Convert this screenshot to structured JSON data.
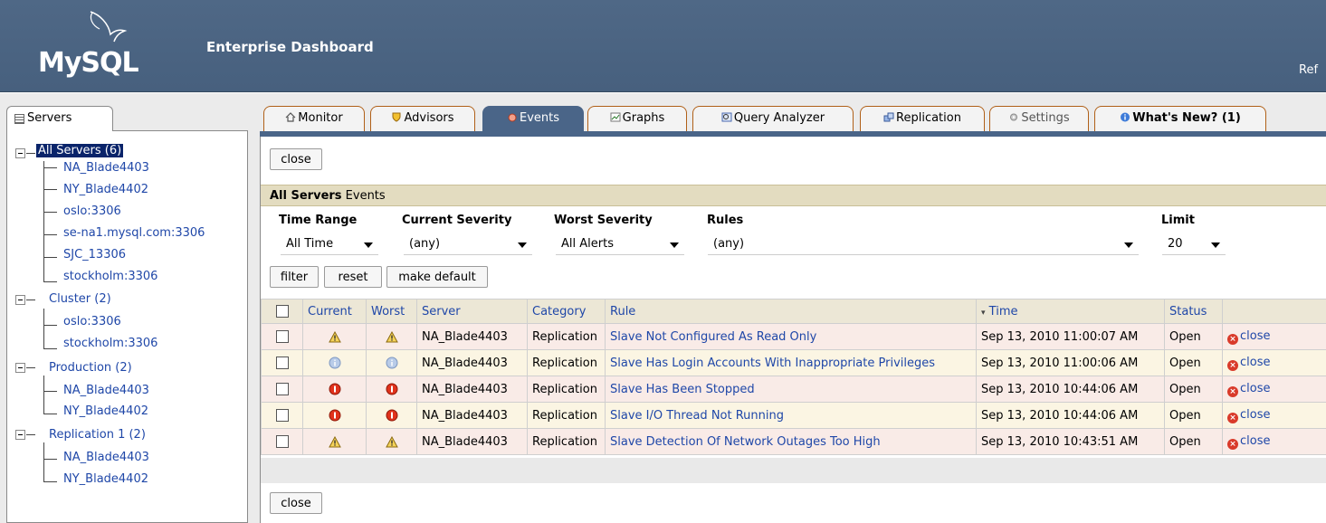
{
  "header": {
    "logo_text": "MySQL",
    "app_title": "Enterprise Dashboard",
    "right_text": "Ref"
  },
  "sidebar": {
    "tab_label": "Servers",
    "tree": [
      {
        "label": "All Servers (6)",
        "selected": true
      },
      {
        "label": "NA_Blade4403"
      },
      {
        "label": "NY_Blade4402"
      },
      {
        "label": "oslo:3306"
      },
      {
        "label": "se-na1.mysql.com:3306"
      },
      {
        "label": "SJC_13306"
      },
      {
        "label": "stockholm:3306"
      },
      {
        "label": "Cluster (2)"
      },
      {
        "label": "oslo:3306"
      },
      {
        "label": "stockholm:3306"
      },
      {
        "label": "Production (2)"
      },
      {
        "label": "NA_Blade4403"
      },
      {
        "label": "NY_Blade4402"
      },
      {
        "label": "Replication 1 (2)"
      },
      {
        "label": "NA_Blade4403"
      },
      {
        "label": "NY_Blade4402"
      }
    ]
  },
  "tabs": [
    {
      "label": "Monitor",
      "icon": "house-icon"
    },
    {
      "label": "Advisors",
      "icon": "shield-icon"
    },
    {
      "label": "Events",
      "icon": "alarm-icon",
      "active": true
    },
    {
      "label": "Graphs",
      "icon": "chart-icon"
    },
    {
      "label": "Query Analyzer",
      "icon": "magnifier-icon"
    },
    {
      "label": "Replication",
      "icon": "replication-icon"
    },
    {
      "label": "Settings",
      "icon": "gear-icon"
    },
    {
      "label": "What's New? (1)",
      "icon": "info-icon"
    }
  ],
  "main": {
    "close_label": "close",
    "section_title_bold": "All Servers",
    "section_title_rest": " Events",
    "filters": {
      "time_range": {
        "label": "Time Range",
        "value": "All Time"
      },
      "current_severity": {
        "label": "Current Severity",
        "value": "(any)"
      },
      "worst_severity": {
        "label": "Worst Severity",
        "value": "All Alerts"
      },
      "rules": {
        "label": "Rules",
        "value": "(any)"
      },
      "limit": {
        "label": "Limit",
        "value": "20"
      }
    },
    "buttons": {
      "filter": "filter",
      "reset": "reset",
      "make_default": "make default"
    }
  },
  "table": {
    "columns": [
      "Current",
      "Worst",
      "Server",
      "Category",
      "Rule",
      "Time",
      "Status"
    ],
    "rows": [
      {
        "current": "warning",
        "worst": "warning",
        "server": "NA_Blade4403",
        "category": "Replication",
        "rule": "Slave Not Configured As Read Only",
        "time": "Sep 13, 2010 11:00:07 AM",
        "status": "Open",
        "action": "close"
      },
      {
        "current": "info",
        "worst": "info",
        "server": "NA_Blade4403",
        "category": "Replication",
        "rule": "Slave Has Login Accounts With Inappropriate Privileges",
        "time": "Sep 13, 2010 11:00:06 AM",
        "status": "Open",
        "action": "close"
      },
      {
        "current": "critical",
        "worst": "critical",
        "server": "NA_Blade4403",
        "category": "Replication",
        "rule": "Slave Has Been Stopped",
        "time": "Sep 13, 2010 10:44:06 AM",
        "status": "Open",
        "action": "close"
      },
      {
        "current": "critical",
        "worst": "critical",
        "server": "NA_Blade4403",
        "category": "Replication",
        "rule": "Slave I/O Thread Not Running",
        "time": "Sep 13, 2010 10:44:06 AM",
        "status": "Open",
        "action": "close"
      },
      {
        "current": "warning",
        "worst": "warning",
        "server": "NA_Blade4403",
        "category": "Replication",
        "rule": "Slave Detection Of Network Outages Too High",
        "time": "Sep 13, 2010 10:43:51 AM",
        "status": "Open",
        "action": "close"
      }
    ]
  },
  "colors": {
    "header_bg": "#4f6886",
    "accent": "#4a6588",
    "section_bar": "#e3dcc0",
    "link": "#1f47a8",
    "row_pink": "#f9ebe7",
    "row_cream": "#fbf5e3"
  }
}
